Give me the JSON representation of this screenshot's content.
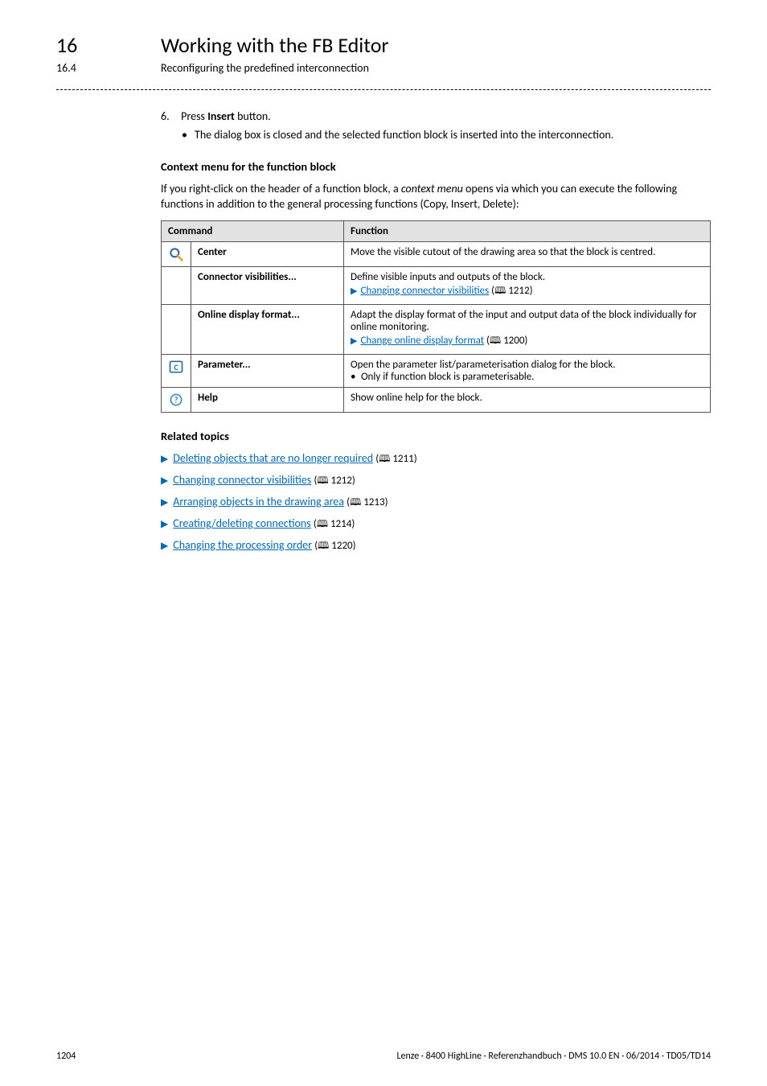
{
  "header": {
    "chapter_number": "16",
    "chapter_title": "Working with the FB Editor",
    "section_number": "16.4",
    "section_title": "Reconfiguring the predefined interconnection"
  },
  "step": {
    "number": "6.",
    "pre": "Press ",
    "bold": "Insert",
    "post": " button.",
    "sub_bullet": "The dialog box is closed and the selected function block is inserted into the interconnection."
  },
  "context_heading": "Context menu for the function block",
  "context_para_pre": "If you right-click on the header of a function block, a ",
  "context_para_em": "context menu",
  "context_para_post": " opens via which you can execute the following functions in addition to the general processing functions (Copy, Insert, Delete):",
  "table": {
    "head_command": "Command",
    "head_function": "Function",
    "rows": {
      "center": {
        "label": "Center",
        "desc": "Move the visible cutout of the drawing area so that the block is centred."
      },
      "connector": {
        "label": "Connector visibilities...",
        "desc": "Define visible inputs and outputs of the block.",
        "link_text": "Changing connector visibilities",
        "link_page": "1212"
      },
      "online": {
        "label": "Online display format...",
        "desc": "Adapt the display format of the input and output data of the block individually for online monitoring.",
        "link_text": "Change online display format",
        "link_page": "1200"
      },
      "parameter": {
        "label": "Parameter...",
        "desc": "Open the parameter list/parameterisation dialog for the block.",
        "bullet": "Only if function block is parameterisable."
      },
      "help": {
        "label": "Help",
        "desc": "Show online help for the block."
      }
    }
  },
  "related": {
    "heading": "Related topics",
    "items": [
      {
        "text": "Deleting objects that are no longer required",
        "page": "1211"
      },
      {
        "text": "Changing connector visibilities",
        "page": "1212"
      },
      {
        "text": "Arranging objects in the drawing area",
        "page": "1213"
      },
      {
        "text": "Creating/deleting connections",
        "page": "1214"
      },
      {
        "text": "Changing the processing order",
        "page": "1220"
      }
    ]
  },
  "footer": {
    "page": "1204",
    "right": "Lenze · 8400 HighLine · Referenzhandbuch · DMS 10.0 EN · 06/2014 · TD05/TD14"
  }
}
